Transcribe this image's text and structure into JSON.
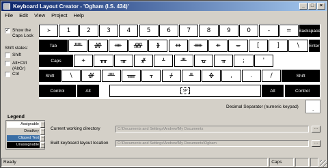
{
  "window": {
    "title": "Keyboard Layout Creator - 'Ogham (I.S. 434)'",
    "minimize": "_",
    "maximize": "□",
    "close": "×"
  },
  "menu": [
    "File",
    "Edit",
    "View",
    "Project",
    "Help"
  ],
  "left_panel": {
    "show_caps_lock": "Show the Caps Lock",
    "show_caps_lock_checked": true,
    "shift_states_label": "Shift states:",
    "shift": "Shift",
    "altctrl": "Alt+Ctrl (AltGr)",
    "ctrl": "Ctrl"
  },
  "keyboard": {
    "row1": [
      "᚛",
      "1",
      "2",
      "3",
      "4",
      "5",
      "6",
      "7",
      "8",
      "9",
      "0",
      "-",
      "="
    ],
    "backspace": "Backspace",
    "tab": "Tab",
    "row2": [
      "ᚊ",
      "ᚎ",
      "ᚓ",
      "ᚏ",
      "ᚕ",
      "ᚒ",
      "ᚔ",
      "ᚑ",
      "ᚚ",
      "[",
      "]",
      "\\"
    ],
    "enter": "Enter",
    "caps": "Caps",
    "row3": [
      "ᚐ",
      "ᚄ",
      "ᚃ",
      "ᚌ",
      "ᚆ",
      "ᚈ",
      "ᚗ",
      "ᚂ",
      ";",
      "'"
    ],
    "shift_left": "Shift",
    "row4": [
      "\\",
      "ᚍ",
      "ᚉ",
      "ᚅ",
      "ᚁ",
      "ᚋ",
      "ᚇ",
      "ᚖ",
      ",",
      ".",
      "/"
    ],
    "shift_right": "Shift",
    "control_left": "Control",
    "alt_left": "Alt",
    "space": "SP",
    "alt_right": "Alt",
    "control_right": "Control"
  },
  "decimal_separator_label": "Decimal Separator (numeric keypad)",
  "decimal_separator_value": ".",
  "legend": {
    "title": "Legend",
    "items": [
      {
        "label": "Assignable",
        "color": "#ffffff",
        "text_color": "#000000"
      },
      {
        "label": "Deadkey",
        "color": "#d4d0c8",
        "text_color": "#000000"
      },
      {
        "label": "Clipped Text",
        "color": "#3a6ea5",
        "text_color": "#ffffff"
      },
      {
        "label": "Unassignable",
        "color": "#000000",
        "text_color": "#ffffff"
      }
    ],
    "button": "..."
  },
  "fields": {
    "cwd_label": "Current working directory",
    "cwd_value": "C:\\Documents and Settings\\Andrew\\My Documents",
    "built_label": "Built keyboard layout location",
    "built_value": "C:\\Documents and Settings\\Andrew\\My Documents\\Ogham",
    "browse": "..."
  },
  "status": {
    "left": "Ready",
    "caps": "Caps"
  }
}
